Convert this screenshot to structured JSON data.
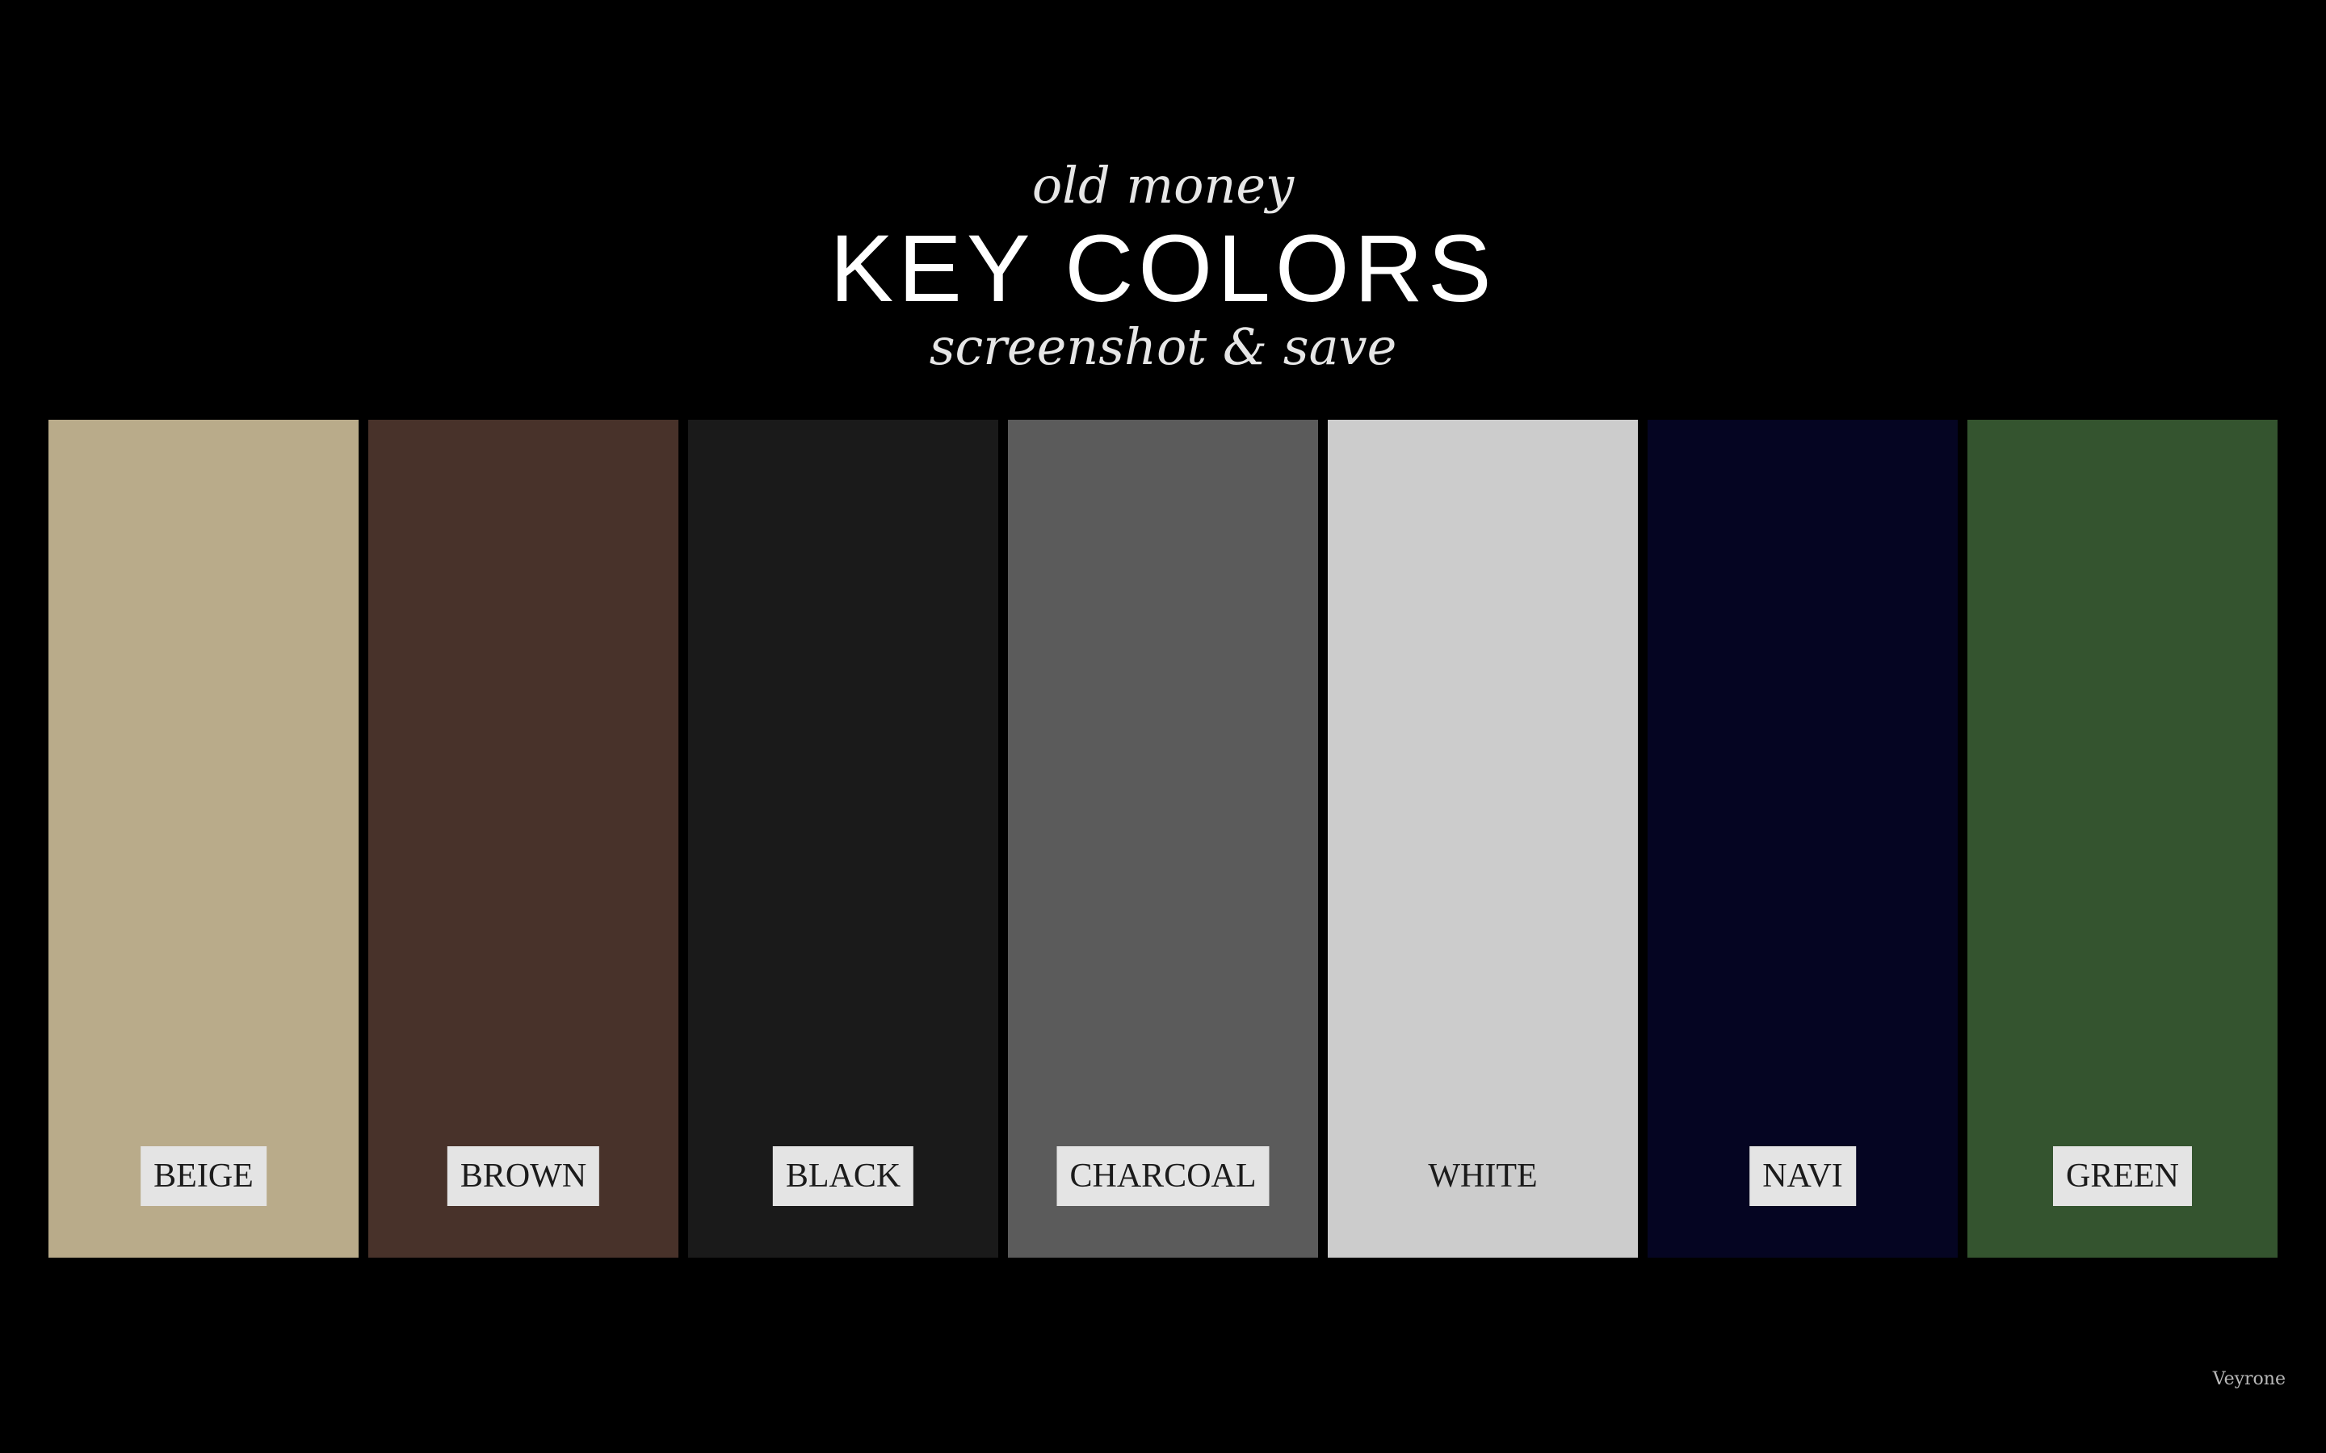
{
  "header": {
    "kicker": "old money",
    "title": "KEY COLORS",
    "tagline": "screenshot & save"
  },
  "swatches": [
    {
      "label": "BEIGE",
      "color": "#b9ab8a"
    },
    {
      "label": "BROWN",
      "color": "#48322a"
    },
    {
      "label": "BLACK",
      "color": "#1a1a1a"
    },
    {
      "label": "CHARCOAL",
      "color": "#5b5b5b"
    },
    {
      "label": "WHITE",
      "color": "#cccccc"
    },
    {
      "label": "NAVI",
      "color": "#050522"
    },
    {
      "label": "GREEN",
      "color": "#34542f"
    }
  ],
  "watermark": "Veyrone"
}
